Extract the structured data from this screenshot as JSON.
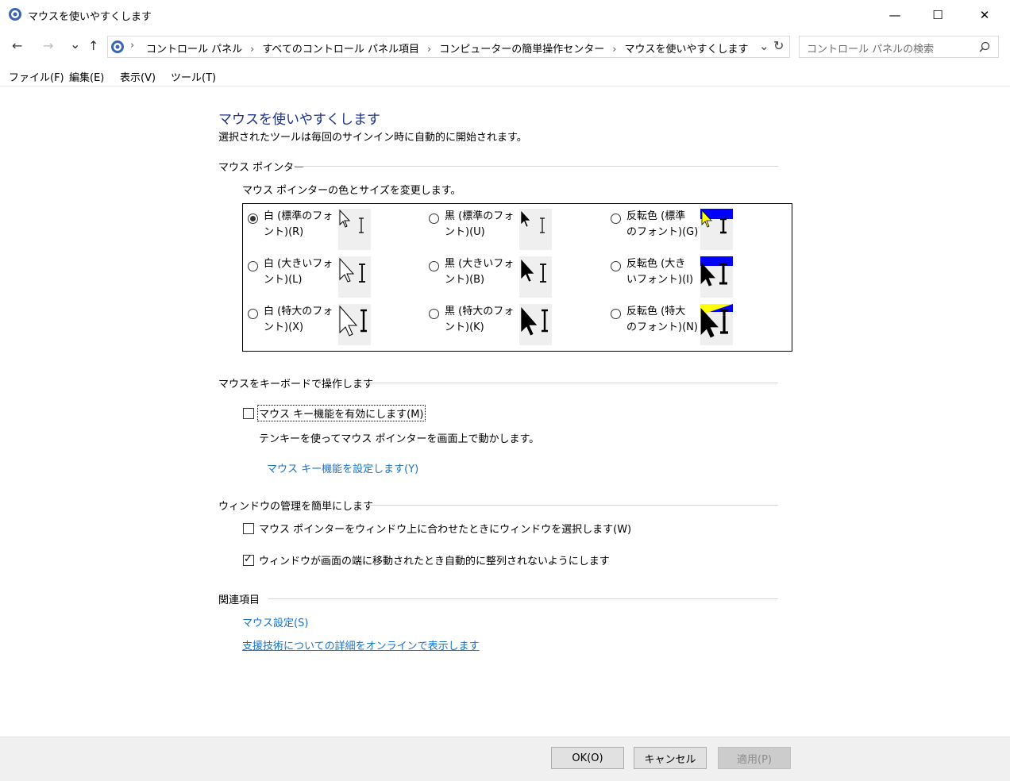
{
  "window": {
    "title": "マウスを使いやすくします",
    "minimize": "—",
    "maximize": "☐",
    "close": "✕"
  },
  "nav": {
    "back": "←",
    "forward": "→",
    "recent": "⌄",
    "up": "↑",
    "breadcrumbs": [
      "コントロール パネル",
      "すべてのコントロール パネル項目",
      "コンピューターの簡単操作センター",
      "マウスを使いやすくします"
    ],
    "search_placeholder": "コントロール パネルの検索"
  },
  "menu": [
    "ファイル(F)",
    "編集(E)",
    "表示(V)",
    "ツール(T)"
  ],
  "page": {
    "title": "マウスを使いやすくします",
    "subtitle": "選択されたツールは毎回のサインイン時に自動的に開始されます。"
  },
  "pointer_section": {
    "heading": "マウス ポインター",
    "description": "マウス ポインターの色とサイズを変更します。",
    "options": [
      {
        "line1": "白 (標準のフォ",
        "line2": "ント)(R)",
        "selected": true
      },
      {
        "line1": "黒 (標準のフォ",
        "line2": "ント)(U)",
        "selected": false
      },
      {
        "line1": "反転色 (標準",
        "line2": "のフォント)(G)",
        "selected": false
      },
      {
        "line1": "白 (大きいフォ",
        "line2": "ント)(L)",
        "selected": false
      },
      {
        "line1": "黒 (大きいフォ",
        "line2": "ント)(B)",
        "selected": false
      },
      {
        "line1": "反転色 (大き",
        "line2": "いフォント)(I)",
        "selected": false
      },
      {
        "line1": "白 (特大のフォ",
        "line2": "ント)(X)",
        "selected": false
      },
      {
        "line1": "黒 (特大のフォ",
        "line2": "ント)(K)",
        "selected": false
      },
      {
        "line1": "反転色 (特大",
        "line2": "のフォント)(N)",
        "selected": false
      }
    ]
  },
  "keyboard_section": {
    "heading": "マウスをキーボードで操作します",
    "mousekeys_label": "マウス キー機能を有効にします(M)",
    "mousekeys_checked": false,
    "mousekeys_desc": "テンキーを使ってマウス ポインターを画面上で動かします。",
    "setup_link": "マウス キー機能を設定します(Y)"
  },
  "window_section": {
    "heading": "ウィンドウの管理を簡単にします",
    "hover_label": "マウス ポインターをウィンドウ上に合わせたときにウィンドウを選択します(W)",
    "hover_checked": false,
    "snap_label": "ウィンドウが画面の端に移動されたとき自動的に整列されないようにします",
    "snap_checked": true
  },
  "related": {
    "heading": "関連項目",
    "mouse_settings": "マウス設定(S)",
    "online_help": "支援技術についての詳細をオンラインで表示します"
  },
  "buttons": {
    "ok": "OK(O)",
    "cancel": "キャンセル",
    "apply": "適用(P)"
  }
}
